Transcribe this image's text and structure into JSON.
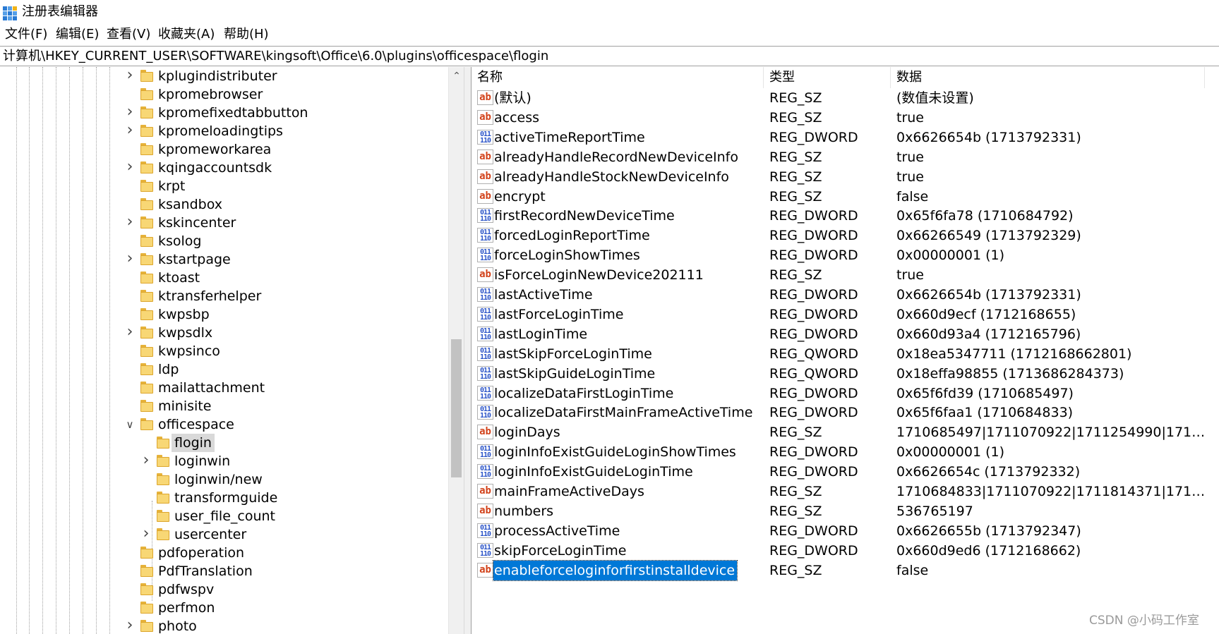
{
  "window": {
    "title": "注册表编辑器",
    "icon": "registry-editor-icon"
  },
  "menu": [
    "文件(F)",
    "编辑(E)",
    "查看(V)",
    "收藏夹(A)",
    "帮助(H)"
  ],
  "address": "计算机\\HKEY_CURRENT_USER\\SOFTWARE\\kingsoft\\Office\\6.0\\plugins\\officespace\\flogin",
  "tree": [
    {
      "label": "kplugindistributer",
      "level": 0,
      "expander": "collapsed"
    },
    {
      "label": "kpromebrowser",
      "level": 0,
      "expander": "none"
    },
    {
      "label": "kpromefixedtabbutton",
      "level": 0,
      "expander": "collapsed"
    },
    {
      "label": "kpromeloadingtips",
      "level": 0,
      "expander": "collapsed"
    },
    {
      "label": "kpromeworkarea",
      "level": 0,
      "expander": "none"
    },
    {
      "label": "kqingaccountsdk",
      "level": 0,
      "expander": "collapsed"
    },
    {
      "label": "krpt",
      "level": 0,
      "expander": "none"
    },
    {
      "label": "ksandbox",
      "level": 0,
      "expander": "none"
    },
    {
      "label": "kskincenter",
      "level": 0,
      "expander": "collapsed"
    },
    {
      "label": "ksolog",
      "level": 0,
      "expander": "none"
    },
    {
      "label": "kstartpage",
      "level": 0,
      "expander": "collapsed"
    },
    {
      "label": "ktoast",
      "level": 0,
      "expander": "none"
    },
    {
      "label": "ktransferhelper",
      "level": 0,
      "expander": "none"
    },
    {
      "label": "kwpsbp",
      "level": 0,
      "expander": "none"
    },
    {
      "label": "kwpsdlx",
      "level": 0,
      "expander": "collapsed"
    },
    {
      "label": "kwpsinco",
      "level": 0,
      "expander": "none"
    },
    {
      "label": "ldp",
      "level": 0,
      "expander": "none"
    },
    {
      "label": "mailattachment",
      "level": 0,
      "expander": "none"
    },
    {
      "label": "minisite",
      "level": 0,
      "expander": "none"
    },
    {
      "label": "officespace",
      "level": 0,
      "expander": "expanded"
    },
    {
      "label": "flogin",
      "level": 1,
      "expander": "none",
      "selected": true
    },
    {
      "label": "loginwin",
      "level": 1,
      "expander": "collapsed"
    },
    {
      "label": "loginwin/new",
      "level": 1,
      "expander": "none"
    },
    {
      "label": "transformguide",
      "level": 1,
      "expander": "none"
    },
    {
      "label": "user_file_count",
      "level": 1,
      "expander": "none"
    },
    {
      "label": "usercenter",
      "level": 1,
      "expander": "collapsed"
    },
    {
      "label": "pdfoperation",
      "level": 0,
      "expander": "none"
    },
    {
      "label": "PdfTranslation",
      "level": 0,
      "expander": "none"
    },
    {
      "label": "pdfwspv",
      "level": 0,
      "expander": "none"
    },
    {
      "label": "perfmon",
      "level": 0,
      "expander": "none"
    },
    {
      "label": "photo",
      "level": 0,
      "expander": "collapsed"
    }
  ],
  "list": {
    "columns": [
      "名称",
      "类型",
      "数据"
    ],
    "rows": [
      {
        "icon": "ab",
        "name": "(默认)",
        "type": "REG_SZ",
        "data": "(数值未设置)"
      },
      {
        "icon": "ab",
        "name": "access",
        "type": "REG_SZ",
        "data": "true"
      },
      {
        "icon": "bin",
        "name": "activeTimeReportTime",
        "type": "REG_DWORD",
        "data": "0x6626654b (1713792331)"
      },
      {
        "icon": "ab",
        "name": "alreadyHandleRecordNewDeviceInfo",
        "type": "REG_SZ",
        "data": "true"
      },
      {
        "icon": "ab",
        "name": "alreadyHandleStockNewDeviceInfo",
        "type": "REG_SZ",
        "data": "true"
      },
      {
        "icon": "ab",
        "name": "encrypt",
        "type": "REG_SZ",
        "data": "false"
      },
      {
        "icon": "bin",
        "name": "firstRecordNewDeviceTime",
        "type": "REG_DWORD",
        "data": "0x65f6fa78 (1710684792)"
      },
      {
        "icon": "bin",
        "name": "forcedLoginReportTime",
        "type": "REG_DWORD",
        "data": "0x66266549 (1713792329)"
      },
      {
        "icon": "bin",
        "name": "forceLoginShowTimes",
        "type": "REG_DWORD",
        "data": "0x00000001 (1)"
      },
      {
        "icon": "ab",
        "name": "isForceLoginNewDevice202111",
        "type": "REG_SZ",
        "data": "true"
      },
      {
        "icon": "bin",
        "name": "lastActiveTime",
        "type": "REG_DWORD",
        "data": "0x6626654b (1713792331)"
      },
      {
        "icon": "bin",
        "name": "lastForceLoginTime",
        "type": "REG_DWORD",
        "data": "0x660d9ecf (1712168655)"
      },
      {
        "icon": "bin",
        "name": "lastLoginTime",
        "type": "REG_DWORD",
        "data": "0x660d93a4 (1712165796)"
      },
      {
        "icon": "bin",
        "name": "lastSkipForceLoginTime",
        "type": "REG_QWORD",
        "data": "0x18ea5347711 (1712168662801)"
      },
      {
        "icon": "bin",
        "name": "lastSkipGuideLoginTime",
        "type": "REG_QWORD",
        "data": "0x18effa98855 (1713686284373)"
      },
      {
        "icon": "bin",
        "name": "localizeDataFirstLoginTime",
        "type": "REG_DWORD",
        "data": "0x65f6fd39 (1710685497)"
      },
      {
        "icon": "bin",
        "name": "localizeDataFirstMainFrameActiveTime",
        "type": "REG_DWORD",
        "data": "0x65f6faa1 (1710684833)"
      },
      {
        "icon": "ab",
        "name": "loginDays",
        "type": "REG_SZ",
        "data": "1710685497|1711070922|1711254990|17114..."
      },
      {
        "icon": "bin",
        "name": "loginInfoExistGuideLoginShowTimes",
        "type": "REG_DWORD",
        "data": "0x00000001 (1)"
      },
      {
        "icon": "bin",
        "name": "loginInfoExistGuideLoginTime",
        "type": "REG_DWORD",
        "data": "0x6626654c (1713792332)"
      },
      {
        "icon": "ab",
        "name": "mainFrameActiveDays",
        "type": "REG_SZ",
        "data": "1710684833|1711070922|1711814371|17118..."
      },
      {
        "icon": "ab",
        "name": "numbers",
        "type": "REG_SZ",
        "data": "536765197"
      },
      {
        "icon": "bin",
        "name": "processActiveTime",
        "type": "REG_DWORD",
        "data": "0x6626655b (1713792347)"
      },
      {
        "icon": "bin",
        "name": "skipForceLoginTime",
        "type": "REG_DWORD",
        "data": "0x660d9ed6 (1712168662)"
      },
      {
        "icon": "ab",
        "name": "enableforceloginforfirstinstalldevice",
        "type": "REG_SZ",
        "data": "false",
        "selected": true
      }
    ]
  },
  "watermark": "CSDN @小码工作室",
  "colors": {
    "selection": "#0078d7",
    "tree_selection": "#d9d9d9",
    "folder": "#f8d775",
    "ab_icon": "#d2421a",
    "binary_icon": "#2b54c8"
  },
  "icons": {
    "ab": "string-value-icon",
    "bin": "binary-value-icon",
    "folder": "folder-icon",
    "collapsed": "chevron-right-icon",
    "expanded": "chevron-down-icon"
  }
}
